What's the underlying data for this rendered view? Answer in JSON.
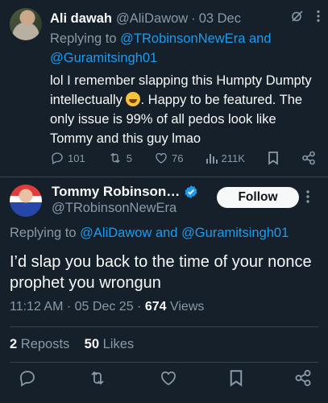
{
  "colors": {
    "background": "#15202b",
    "accent": "#1d9bf0",
    "text": "#f7f9f9",
    "muted": "#8b98a5",
    "divider": "#38444d"
  },
  "reply_tweet": {
    "author_name": "Ali dawah",
    "handle": "@AliDawow",
    "separator": "·",
    "date": "03 Dec",
    "replying_prefix": "Replying to",
    "replying_mention_1": "@TRobinsonNewEra",
    "replying_and": "and",
    "replying_mention_2": "@Guramitsingh01",
    "text_before_emoji": "lol I remember slapping this Humpty Dumpty intellectually",
    "text_after_emoji": ". Happy to be featured. The only issue is 99% of all pedos look like Tommy and this guy lmao",
    "emoji_name": "grinning-sweat-emoji",
    "replies": "101",
    "reposts": "5",
    "likes": "76",
    "views": "211K",
    "icons": [
      "grok-icon",
      "more-icon",
      "reply-icon",
      "repost-icon",
      "like-icon",
      "views-icon",
      "bookmark-icon",
      "share-icon"
    ]
  },
  "main_tweet": {
    "author_name": "Tommy Robinson…",
    "handle": "@TRobinsonNewEra",
    "follow_label": "Follow",
    "replying_prefix": "Replying to",
    "replying_mention_1": "@AliDawow",
    "replying_and": "and",
    "replying_mention_2": "@Guramitsingh01",
    "text": "I’d slap you back to the time of your nonce prophet you wrongun",
    "time": "11:12 AM",
    "separator": "·",
    "date": "05 Dec 25",
    "separator2": "·",
    "views_count": "674",
    "views_label": "Views",
    "reposts_count": "2",
    "reposts_label": "Reposts",
    "likes_count": "50",
    "likes_label": "Likes",
    "icons": [
      "verified-badge-icon",
      "more-icon",
      "reply-icon",
      "repost-icon",
      "like-icon",
      "bookmark-icon",
      "share-icon"
    ]
  }
}
